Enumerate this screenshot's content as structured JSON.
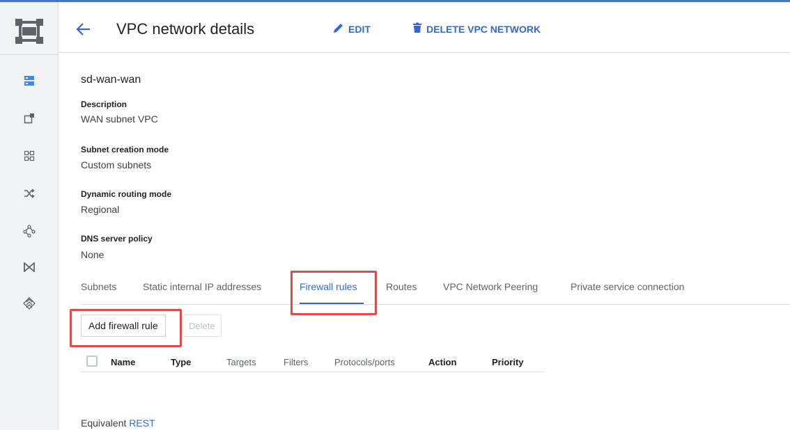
{
  "header": {
    "title": "VPC network details",
    "edit_label": "EDIT",
    "delete_label": "DELETE VPC NETWORK",
    "accent_color": "#3367d6"
  },
  "rail": {
    "logo_icon": "vpc-network-logo-icon",
    "items": [
      {
        "icon": "vpc-networks-icon",
        "active": true
      },
      {
        "icon": "external-ip-addresses-icon",
        "active": false
      },
      {
        "icon": "firewall-icon",
        "active": false
      },
      {
        "icon": "routes-icon",
        "active": false
      },
      {
        "icon": "vpc-peering-icon",
        "active": false
      },
      {
        "icon": "shared-vpc-icon",
        "active": false
      },
      {
        "icon": "serverless-vpc-access-icon",
        "active": false
      }
    ]
  },
  "network": {
    "name": "sd-wan-wan",
    "properties": [
      {
        "label": "Description",
        "value": "WAN subnet VPC"
      },
      {
        "label": "Subnet creation mode",
        "value": "Custom subnets"
      },
      {
        "label": "Dynamic routing mode",
        "value": "Regional"
      },
      {
        "label": "DNS server policy",
        "value": "None"
      }
    ]
  },
  "tabs": [
    {
      "label": "Subnets",
      "active": false
    },
    {
      "label": "Static internal IP addresses",
      "active": false
    },
    {
      "label": "Firewall rules",
      "active": true
    },
    {
      "label": "Routes",
      "active": false
    },
    {
      "label": "VPC Network Peering",
      "active": false
    },
    {
      "label": "Private service connection",
      "active": false
    }
  ],
  "actions": {
    "add_label": "Add firewall rule",
    "delete_label": "Delete"
  },
  "table": {
    "columns": [
      "Name",
      "Type",
      "Targets",
      "Filters",
      "Protocols/ports",
      "Action",
      "Priority"
    ]
  },
  "footer": {
    "equivalent_label": "Equivalent",
    "rest_link": "REST"
  },
  "highlight_color": "#e04a4a"
}
